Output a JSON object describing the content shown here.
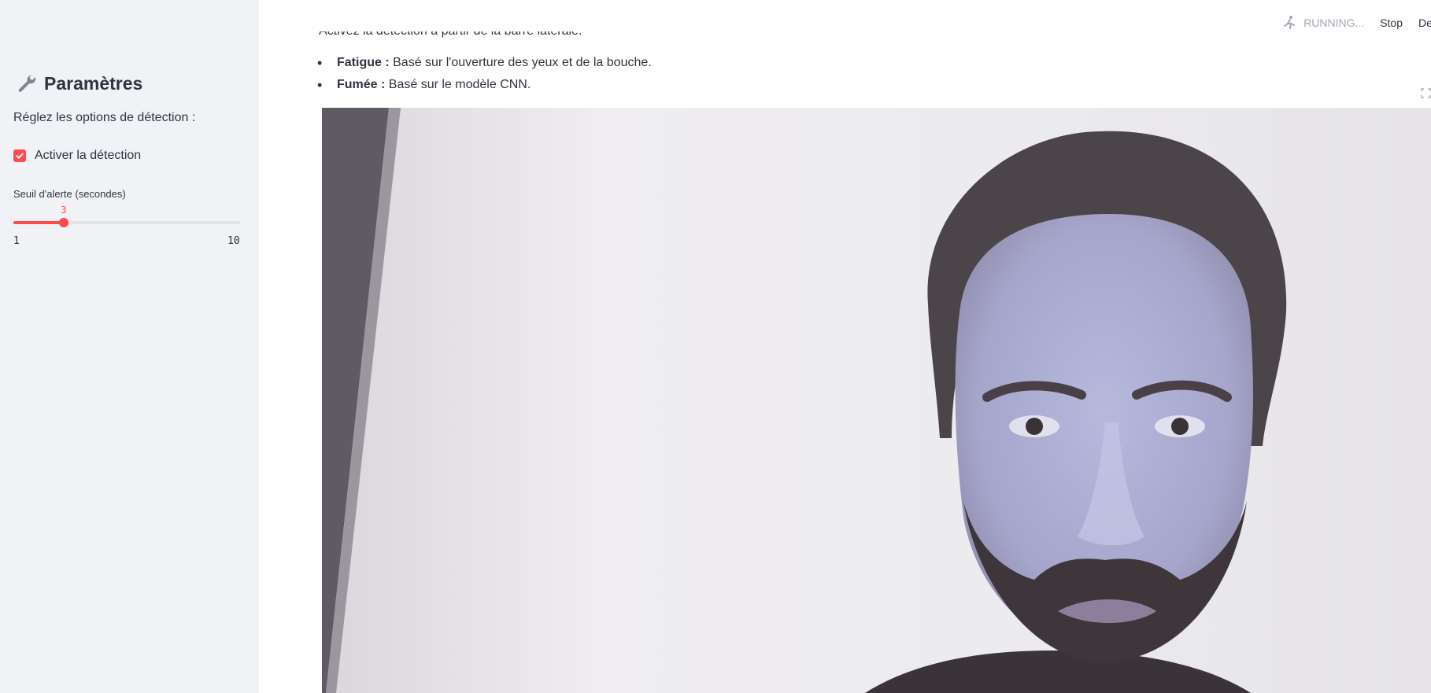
{
  "sidebar": {
    "title": "Paramètres",
    "title_icon": "wrench-icon",
    "subtitle": "Réglez les options de détection :",
    "checkbox": {
      "label": "Activer la détection",
      "checked": true
    },
    "slider": {
      "label": "Seuil d'alerte (secondes)",
      "min": "1",
      "max": "10",
      "value": "3",
      "fraction": 0.2222
    }
  },
  "main": {
    "cut_line": "Activez la détection à partir de la barre latérale.",
    "features": [
      {
        "bold": "Fatigue :",
        "text": " Basé sur l'ouverture des yeux et de la bouche."
      },
      {
        "bold": "Fumée :",
        "text": " Basé sur le modèle CNN."
      }
    ]
  },
  "header": {
    "status": "RUNNING...",
    "status_icon": "running-figure-icon",
    "stop_label": "Stop",
    "deploy_label": "Deploy"
  },
  "colors": {
    "accent": "#ff4b4b",
    "sidebar_bg": "#f0f2f6",
    "text": "#31333f",
    "muted": "#a3a8b4"
  }
}
